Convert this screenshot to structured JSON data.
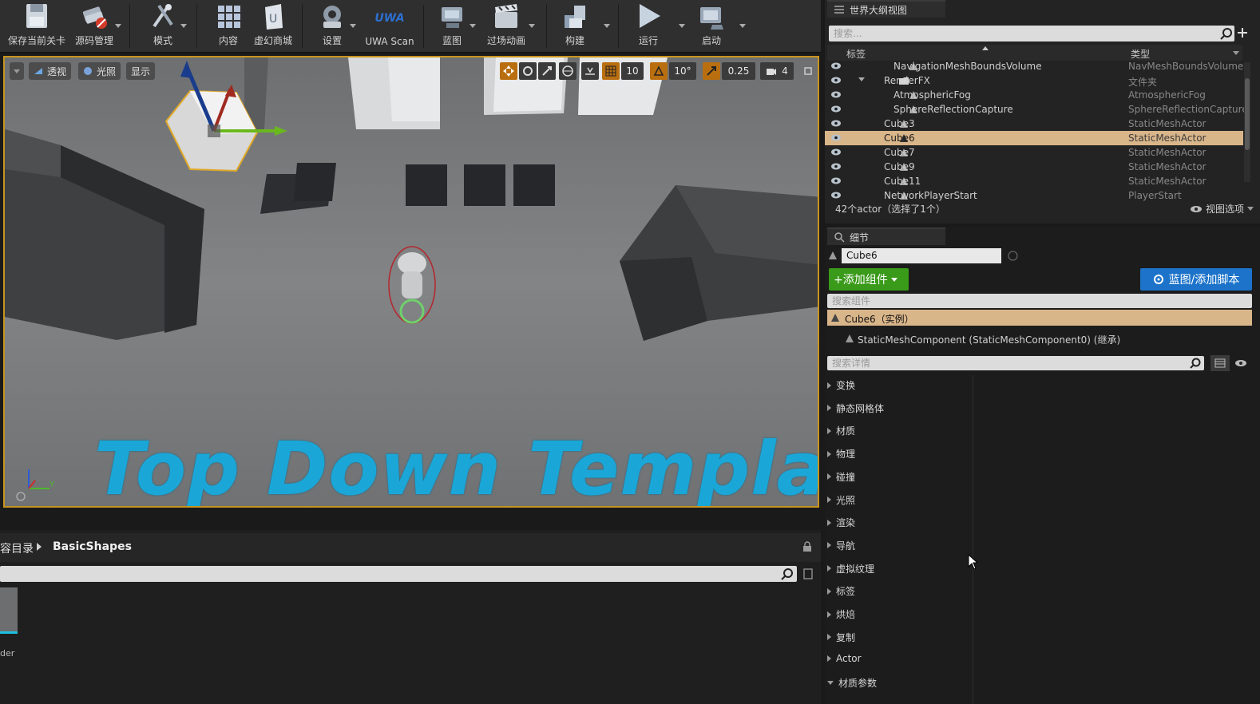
{
  "toolbar": {
    "buttons": [
      {
        "label": "保存当前关卡",
        "icon": "save-icon"
      },
      {
        "label": "源码管理",
        "icon": "source-control-icon"
      },
      {
        "label": "模式",
        "icon": "modes-icon"
      },
      {
        "label": "内容",
        "icon": "content-icon"
      },
      {
        "label": "虚幻商城",
        "icon": "marketplace-icon"
      },
      {
        "label": "设置",
        "icon": "settings-icon"
      },
      {
        "label": "UWA Scan",
        "icon": "uwa-scan-icon",
        "logo_text": "UWA"
      },
      {
        "label": "蓝图",
        "icon": "blueprint-icon"
      },
      {
        "label": "过场动画",
        "icon": "cinematics-icon"
      },
      {
        "label": "构建",
        "icon": "build-icon"
      },
      {
        "label": "运行",
        "icon": "play-icon"
      },
      {
        "label": "启动",
        "icon": "launch-icon"
      }
    ]
  },
  "viewport": {
    "view_mode": "透视",
    "lighting": "光照",
    "show": "显示",
    "grid_snap": "10",
    "rotation_snap": "10°",
    "scale_snap": "0.25",
    "camera_speed": "4",
    "banner_text": "Top Down Template",
    "axis_y": "Y",
    "accent_color": "#c8941e"
  },
  "content_browser": {
    "breadcrumb_root": "容目录",
    "breadcrumb_current": "BasicShapes",
    "asset_label": "der"
  },
  "outliner": {
    "tab_title": "世界大纲视图",
    "search_placeholder": "搜索...",
    "col_label": "标签",
    "col_type": "类型",
    "rows": [
      {
        "name": "NavigationMeshBoundsVolume",
        "type": "NavMeshBoundsVolume",
        "indent": 2,
        "icon": "volume-icon"
      },
      {
        "name": "RenderFX",
        "type": "文件夹",
        "indent": 1,
        "icon": "folder-icon"
      },
      {
        "name": "AtmosphericFog",
        "type": "AtmosphericFog",
        "indent": 2,
        "icon": "fog-icon"
      },
      {
        "name": "SphereReflectionCapture",
        "type": "SphereReflectionCapture",
        "indent": 2,
        "icon": "reflection-icon"
      },
      {
        "name": "Cube3",
        "type": "StaticMeshActor",
        "indent": 1,
        "icon": "static-mesh-icon"
      },
      {
        "name": "Cube6",
        "type": "StaticMeshActor",
        "indent": 1,
        "icon": "static-mesh-icon",
        "selected": true
      },
      {
        "name": "Cube7",
        "type": "StaticMeshActor",
        "indent": 1,
        "icon": "static-mesh-icon"
      },
      {
        "name": "Cube9",
        "type": "StaticMeshActor",
        "indent": 1,
        "icon": "static-mesh-icon"
      },
      {
        "name": "Cube11",
        "type": "StaticMeshActor",
        "indent": 1,
        "icon": "static-mesh-icon"
      },
      {
        "name": "NetworkPlayerStart",
        "type": "PlayerStart",
        "indent": 1,
        "icon": "player-start-icon"
      }
    ],
    "status": "42个actor（选择了1个）",
    "view_options": "视图选项"
  },
  "details": {
    "tab_title": "细节",
    "name_value": "Cube6",
    "add_component": "+添加组件",
    "blueprint_button": "蓝图/添加脚本",
    "search_components": "搜索组件",
    "instance_label": "Cube6（实例）",
    "component_label": "StaticMeshComponent (StaticMeshComponent0) (继承)",
    "search_details": "搜索详情",
    "categories": [
      "变换",
      "静态网格体",
      "材质",
      "物理",
      "碰撞",
      "光照",
      "渲染",
      "导航",
      "虚拟纹理",
      "标签",
      "烘焙",
      "复制",
      "Actor",
      "材质参数"
    ]
  }
}
